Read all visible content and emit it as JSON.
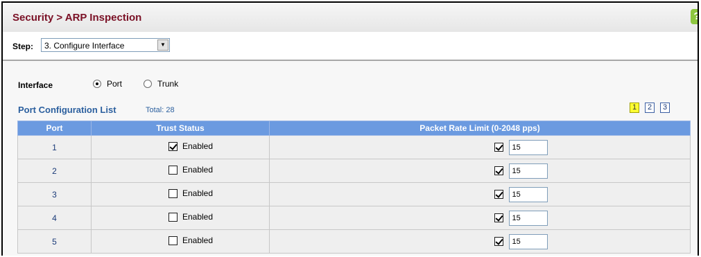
{
  "header": {
    "title": "Security > ARP Inspection",
    "help_symbol": "?"
  },
  "step": {
    "label": "Step:",
    "selected": "3. Configure Interface"
  },
  "interface": {
    "label": "Interface",
    "options": [
      {
        "label": "Port",
        "selected": true
      },
      {
        "label": "Trunk",
        "selected": false
      }
    ]
  },
  "list": {
    "title": "Port Configuration List",
    "total": "Total: 28"
  },
  "pager": {
    "pages": [
      "1",
      "2",
      "3"
    ],
    "current": "1"
  },
  "table": {
    "columns": [
      "Port",
      "Trust Status",
      "Packet Rate Limit (0-2048 pps)"
    ],
    "rows": [
      {
        "port": "1",
        "trust_label": "Enabled",
        "trust_checked": true,
        "rate_checked": true,
        "rate": "15"
      },
      {
        "port": "2",
        "trust_label": "Enabled",
        "trust_checked": false,
        "rate_checked": true,
        "rate": "15"
      },
      {
        "port": "3",
        "trust_label": "Enabled",
        "trust_checked": false,
        "rate_checked": true,
        "rate": "15"
      },
      {
        "port": "4",
        "trust_label": "Enabled",
        "trust_checked": false,
        "rate_checked": true,
        "rate": "15"
      },
      {
        "port": "5",
        "trust_label": "Enabled",
        "trust_checked": false,
        "rate_checked": true,
        "rate": "15"
      }
    ]
  },
  "colors": {
    "title": "#7a1025",
    "header_bg": "#6b9ae0",
    "link": "#2b5f9e",
    "help_bg": "#8dc63f",
    "current_page": "#ffff33"
  }
}
